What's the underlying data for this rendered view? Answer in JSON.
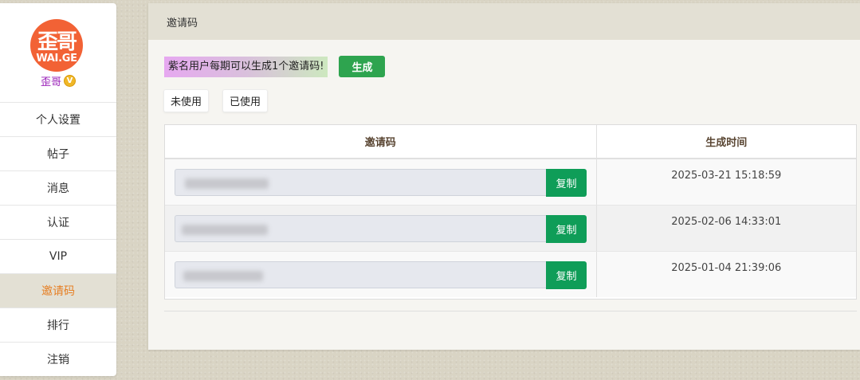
{
  "sidebar": {
    "avatar_mark": "歪哥",
    "avatar_brand": "WAI.GE",
    "username": "歪哥",
    "vip_badge": "V",
    "items": [
      {
        "label": "个人设置"
      },
      {
        "label": "帖子"
      },
      {
        "label": "消息"
      },
      {
        "label": "认证"
      },
      {
        "label": "VIP"
      },
      {
        "label": "邀请码",
        "active": true
      },
      {
        "label": "排行"
      },
      {
        "label": "注销"
      }
    ]
  },
  "panel": {
    "title": "邀请码",
    "notice": "紫名用户每期可以生成1个邀请码!",
    "generate_label": "生成",
    "filters": {
      "unused": "未使用",
      "used": "已使用"
    },
    "table": {
      "headers": {
        "code": "邀请码",
        "time": "生成时间"
      },
      "copy_label": "复制",
      "rows": [
        {
          "time": "2025-03-21 15:18:59"
        },
        {
          "time": "2025-02-06 14:33:01"
        },
        {
          "time": "2025-01-04 21:39:06"
        }
      ]
    }
  },
  "colors": {
    "accent_active": "#e67e22",
    "generate_button": "#2ea44f",
    "copy_button": "#0f9d58",
    "username": "#9a20b8"
  }
}
